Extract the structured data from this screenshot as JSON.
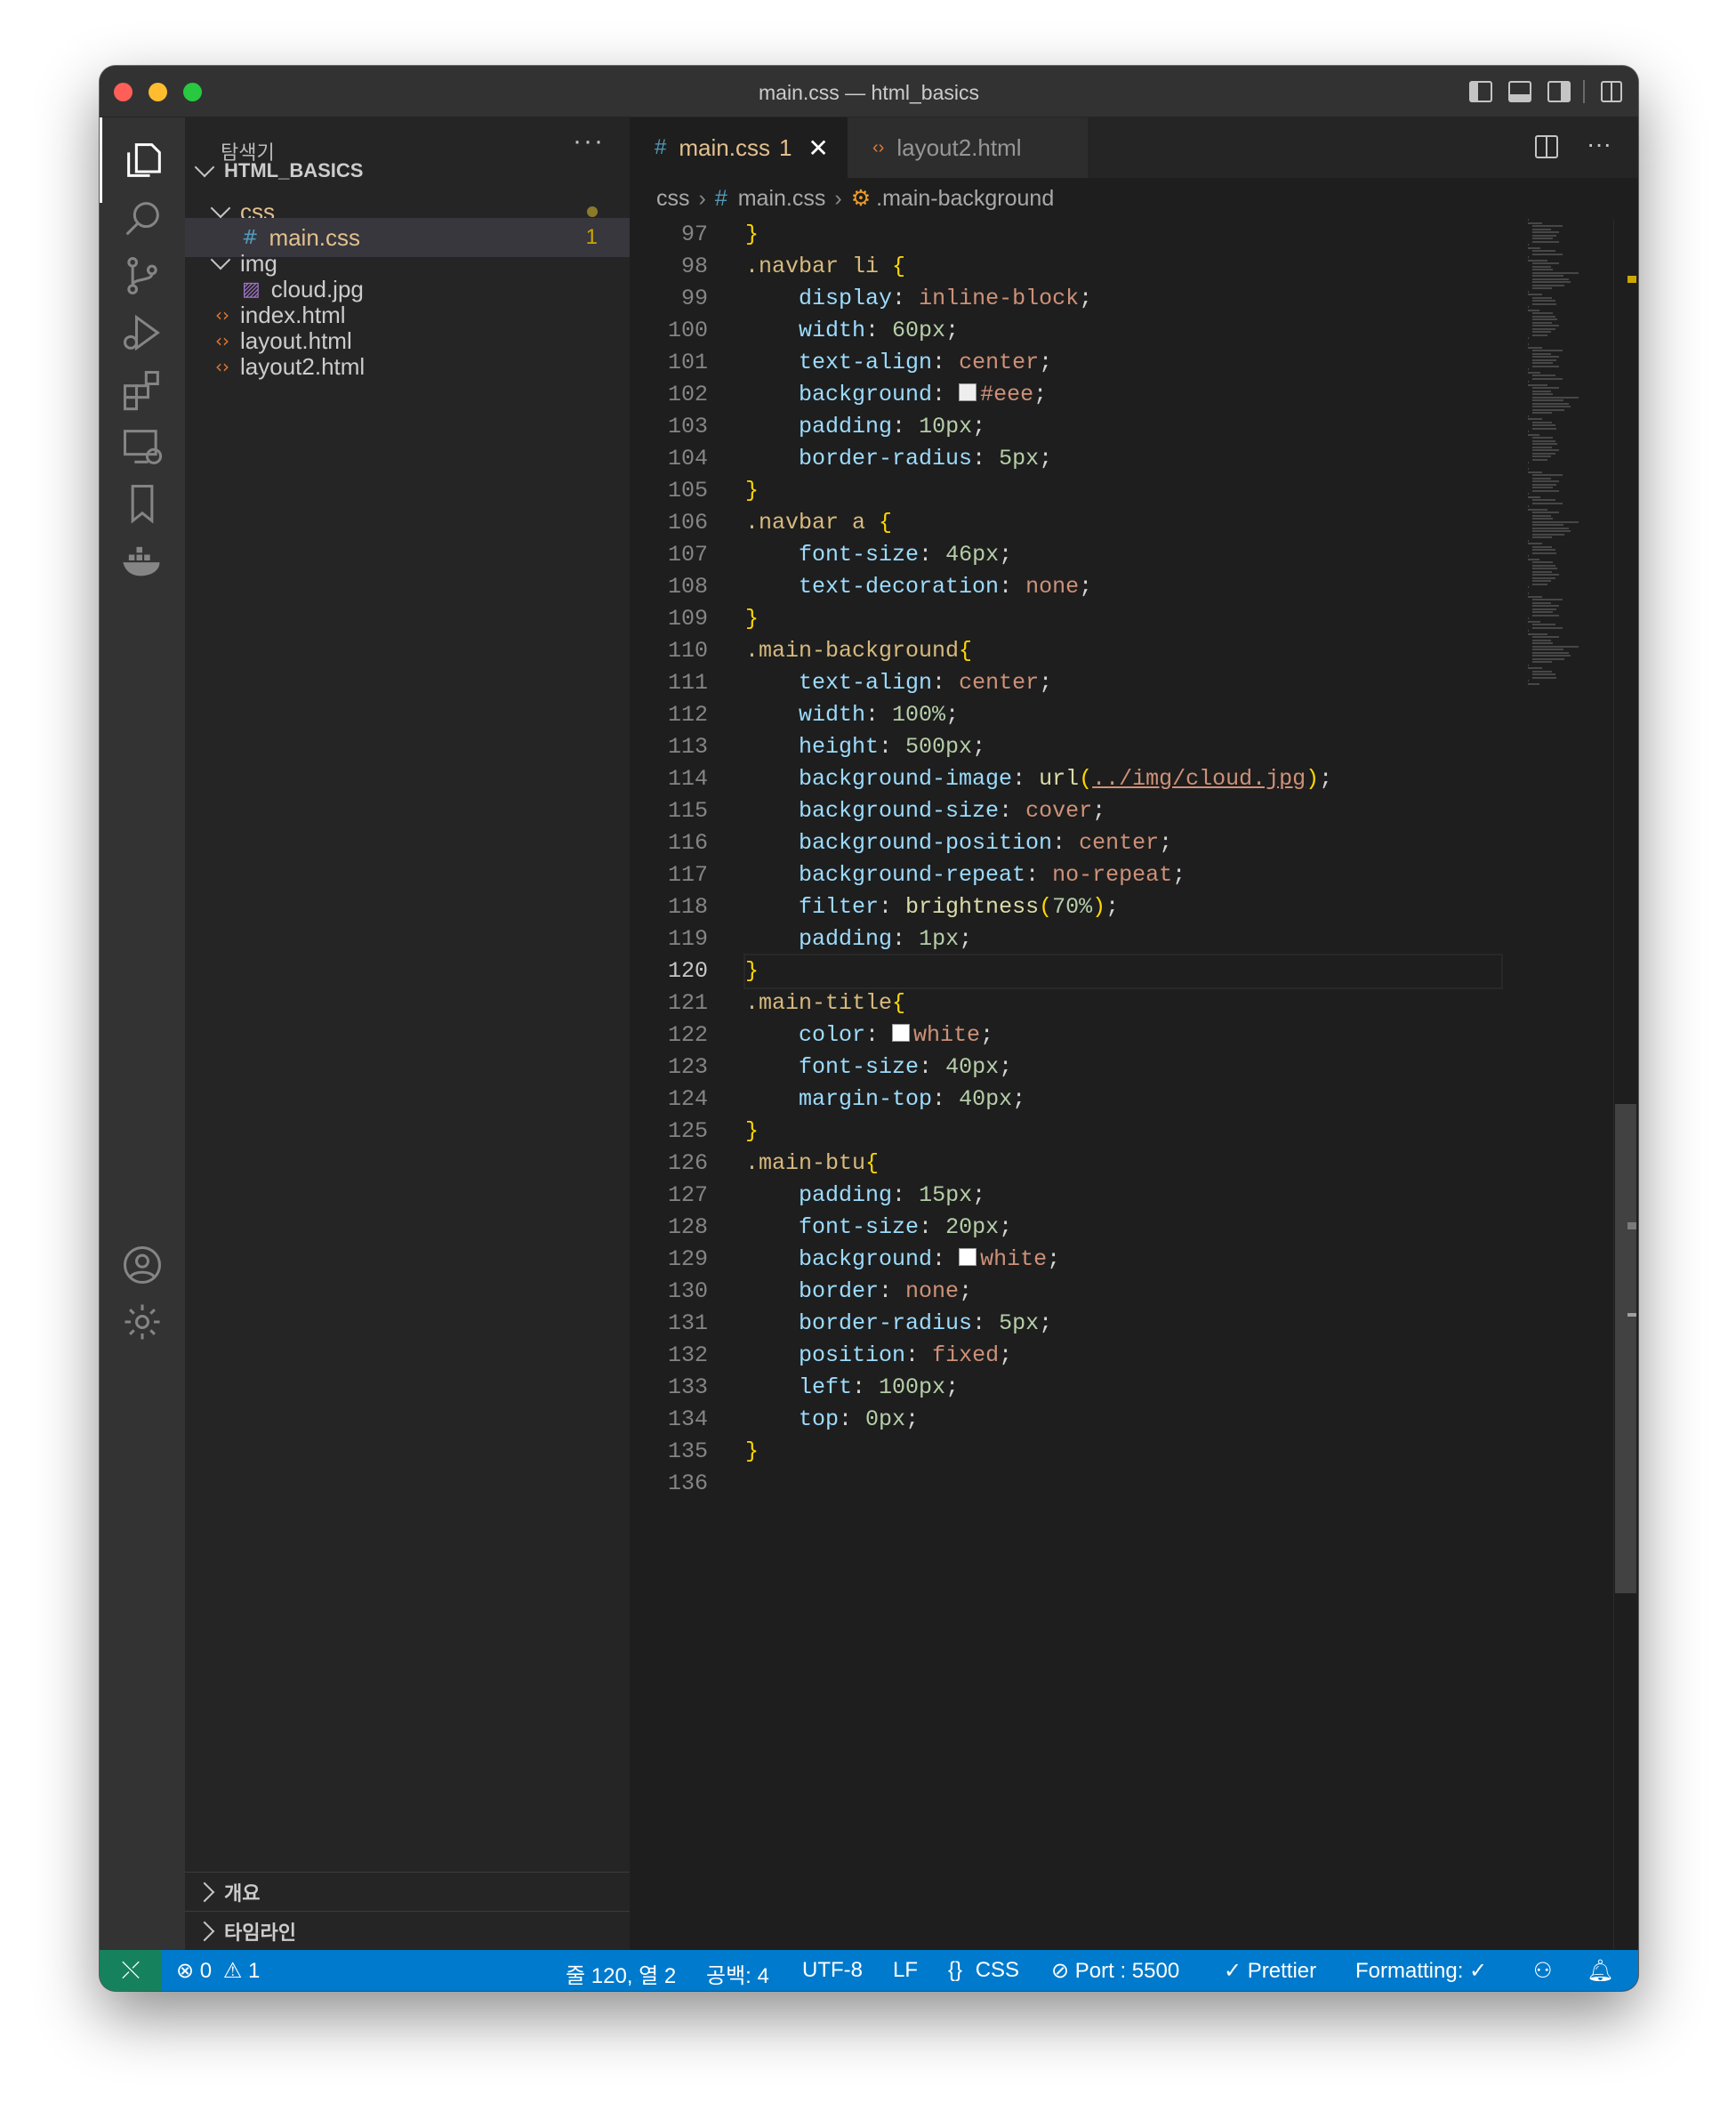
{
  "window": {
    "title": "main.css — html_basics"
  },
  "sidebar": {
    "header": "탐색기",
    "more": "···",
    "root": "HTML_BASICS",
    "items": [
      {
        "label": "css",
        "type": "folder"
      },
      {
        "label": "main.css",
        "type": "css",
        "badge": "1"
      },
      {
        "label": "img",
        "type": "folder"
      },
      {
        "label": "cloud.jpg",
        "type": "image"
      },
      {
        "label": "index.html",
        "type": "html"
      },
      {
        "label": "layout.html",
        "type": "html"
      },
      {
        "label": "layout2.html",
        "type": "html"
      }
    ],
    "sections": [
      "개요",
      "타임라인"
    ]
  },
  "tabs": [
    {
      "label": "main.css",
      "badge": "1",
      "active": true
    },
    {
      "label": "layout2.html",
      "active": false
    }
  ],
  "tab_more": "···",
  "breadcrumb": [
    "css",
    "main.css",
    ".main-background"
  ],
  "editor": {
    "line_numbers": [
      "97",
      "98",
      "99",
      "100",
      "101",
      "102",
      "103",
      "104",
      "105",
      "106",
      "107",
      "108",
      "109",
      "110",
      "111",
      "112",
      "113",
      "114",
      "115",
      "116",
      "117",
      "118",
      "119",
      "120",
      "121",
      "122",
      "123",
      "124",
      "125",
      "126",
      "127",
      "128",
      "129",
      "130",
      "131",
      "132",
      "133",
      "134",
      "135",
      "136"
    ],
    "current_line": "120",
    "lines": [
      "}",
      ".navbar li {",
      "    display: inline-block;",
      "    width: 60px;",
      "    text-align: center;",
      "    background: #eee;",
      "    padding: 10px;",
      "    border-radius: 5px;",
      "}",
      ".navbar a {",
      "    font-size: 46px;",
      "    text-decoration: none;",
      "}",
      ".main-background{",
      "    text-align: center;",
      "    width: 100%;",
      "    height: 500px;",
      "    background-image: url(../img/cloud.jpg);",
      "    background-size: cover;",
      "    background-position: center;",
      "    background-repeat: no-repeat;",
      "    filter: brightness(70%);",
      "    padding: 1px;",
      "}",
      ".main-title{",
      "    color: white;",
      "    font-size: 40px;",
      "    margin-top: 40px;",
      "}",
      ".main-btu{",
      "    padding: 15px;",
      "    font-size: 20px;",
      "    background: white;",
      "    border: none;",
      "    border-radius: 5px;",
      "    position: fixed;",
      "    left: 100px;",
      "    top: 0px;",
      "}",
      ""
    ]
  },
  "colors": {
    "status_bar": "#007acc",
    "remote": "#16825d",
    "selector": "#d7ba7d",
    "property": "#9cdcfe",
    "value": "#ce9178",
    "number": "#b5cea8",
    "bracket": "#ffd700"
  },
  "statusbar": {
    "remote_icon": "remote-icon",
    "errors": "0",
    "warnings": "1",
    "position": "줄 120, 열 2",
    "spaces": "공백: 4",
    "encoding": "UTF-8",
    "eol": "LF",
    "language": "CSS",
    "port": "Port : 5500",
    "prettier": "Prettier",
    "formatting": "Formatting: ✓"
  }
}
